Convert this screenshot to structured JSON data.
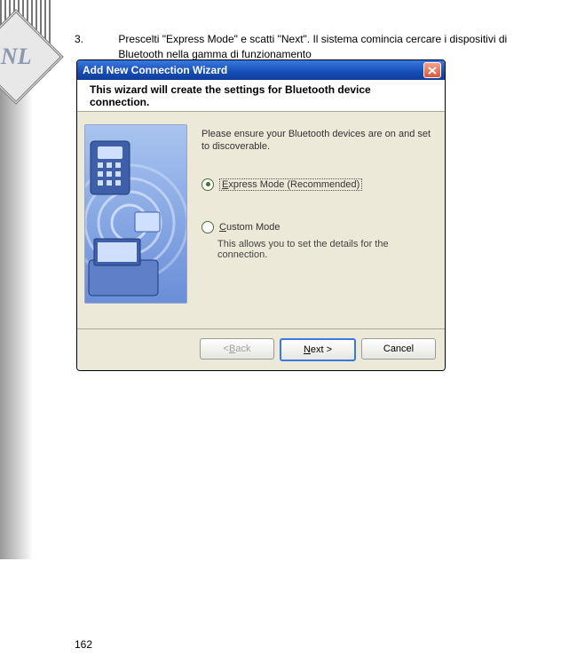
{
  "sidebar": {
    "logo_text": "NL"
  },
  "instruction": {
    "number": "3.",
    "text": "Prescelti \"Express Mode\" e scatti \"Next\". Il sistema comincia cercare i dispositivi di Bluetooth nella gamma di funzionamento"
  },
  "wizard": {
    "title": "Add New Connection Wizard",
    "header": "This wizard will create the settings for Bluetooth device connection.",
    "advice": "Please ensure your Bluetooth devices are on and set to discoverable.",
    "options": {
      "express": {
        "label_prefix_underlined": "E",
        "label_rest": "xpress Mode (Recommended)",
        "checked": true
      },
      "custom": {
        "label_prefix_underlined": "C",
        "label_rest": "ustom Mode",
        "sublabel": "This allows you to set the details for the connection.",
        "checked": false
      }
    },
    "buttons": {
      "back_prefix": "< ",
      "back_underlined": "B",
      "back_rest": "ack",
      "next_underlined": "N",
      "next_rest": "ext >",
      "cancel": "Cancel"
    }
  },
  "page_number": "162"
}
